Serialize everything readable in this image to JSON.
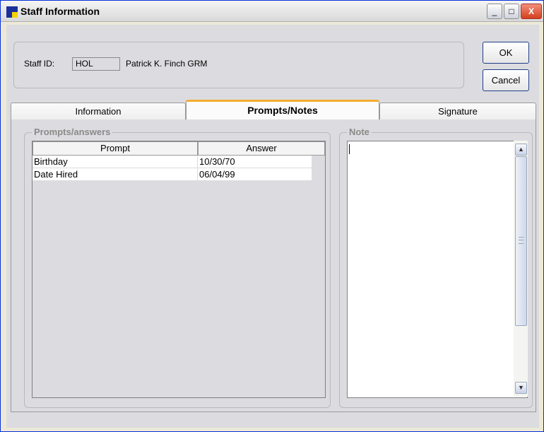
{
  "window": {
    "title": "Staff Information"
  },
  "titlebar": {
    "minimize": "_",
    "maximize": "□",
    "close": "X"
  },
  "staff": {
    "id_label": "Staff ID:",
    "id_value": "HOL",
    "name": "Patrick K. Finch GRM"
  },
  "buttons": {
    "ok": "OK",
    "cancel": "Cancel"
  },
  "tabs": [
    {
      "label": "Information"
    },
    {
      "label": "Prompts/Notes",
      "active": true
    },
    {
      "label": "Signature"
    }
  ],
  "prompts_group": {
    "title": "Prompts/answers",
    "columns": [
      "Prompt",
      "Answer"
    ],
    "rows": [
      {
        "prompt": "Birthday",
        "answer": "10/30/70"
      },
      {
        "prompt": "Date Hired",
        "answer": "06/04/99"
      }
    ]
  },
  "note_group": {
    "title": "Note",
    "value": ""
  },
  "icons": {
    "app": "staff-app-icon",
    "scroll_up": "chevron-up-icon",
    "scroll_down": "chevron-down-icon"
  },
  "colors": {
    "active_tab_accent": "#f3ad32",
    "window_bg": "#dcdce0"
  }
}
